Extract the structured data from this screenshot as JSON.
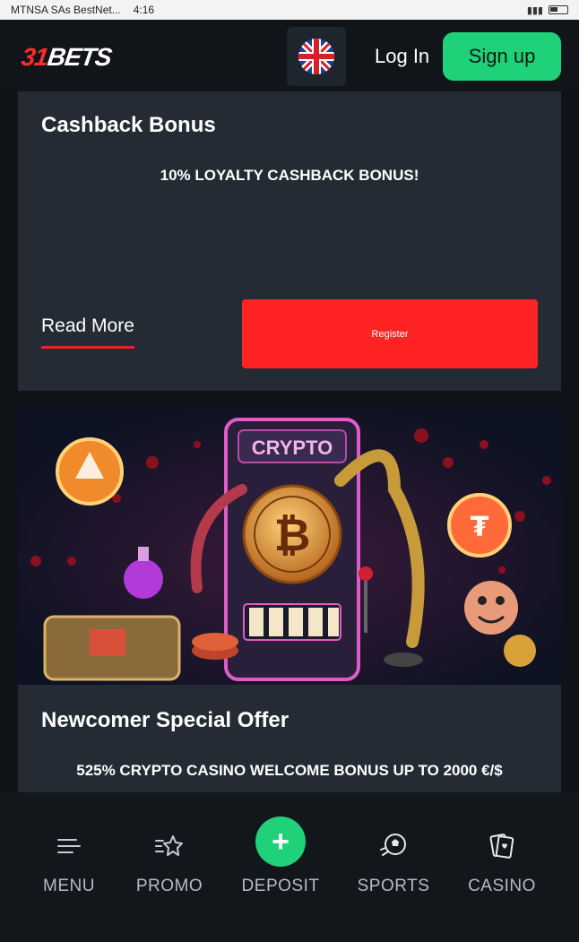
{
  "statusbar": {
    "carrier": "MTNSA SAs BestNet...",
    "time": "4:16"
  },
  "header": {
    "logo": {
      "red": "31",
      "white": "BETS"
    },
    "language_flag": "uk-flag-icon",
    "login_label": "Log In",
    "signup_label": "Sign up"
  },
  "promotions": [
    {
      "title": "Cashback Bonus",
      "subtitle": "10% LOYALTY CASHBACK BONUS!",
      "read_more_label": "Read More",
      "register_label": "Register"
    },
    {
      "banner_text": "CRYPTO",
      "title": "Newcomer Special Offer",
      "subtitle": "525% CRYPTO CASINO WELCOME BONUS UP TO 2000 €/$"
    }
  ],
  "bottom_nav": [
    {
      "label": "MENU",
      "icon": "menu-icon"
    },
    {
      "label": "PROMO",
      "icon": "promo-star-icon"
    },
    {
      "label": "DEPOSIT",
      "icon": "plus-icon"
    },
    {
      "label": "SPORTS",
      "icon": "soccer-ball-icon"
    },
    {
      "label": "CASINO",
      "icon": "cards-icon"
    }
  ],
  "colors": {
    "accent_green": "#1fd27a",
    "accent_red": "#ff2323",
    "card_bg": "#252b34"
  }
}
